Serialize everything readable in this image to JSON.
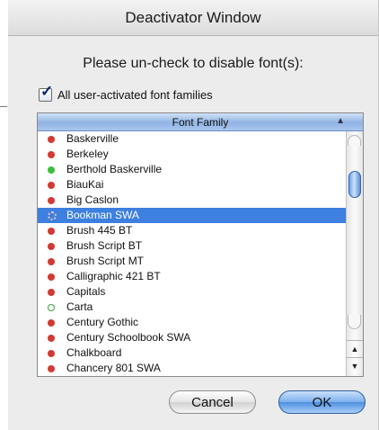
{
  "window": {
    "title": "Deactivator Window",
    "prompt": "Please un-check to disable font(s):"
  },
  "checkbox": {
    "label": "All user-activated font families",
    "checked": true
  },
  "list": {
    "column_header": "Font Family",
    "items": [
      {
        "name": "Baskerville",
        "status": "red"
      },
      {
        "name": "Berkeley",
        "status": "red"
      },
      {
        "name": "Berthold Baskerville",
        "status": "green"
      },
      {
        "name": "BiauKai",
        "status": "red"
      },
      {
        "name": "Big Caslon",
        "status": "red"
      },
      {
        "name": "Bookman SWA",
        "status": "broken",
        "selected": true
      },
      {
        "name": "Brush 445 BT",
        "status": "red"
      },
      {
        "name": "Brush Script BT",
        "status": "red"
      },
      {
        "name": "Brush Script MT",
        "status": "red"
      },
      {
        "name": "Calligraphic 421 BT",
        "status": "red"
      },
      {
        "name": "Capitals",
        "status": "red"
      },
      {
        "name": "Carta",
        "status": "hollow-green"
      },
      {
        "name": "Century Gothic",
        "status": "red"
      },
      {
        "name": "Century Schoolbook SWA",
        "status": "red"
      },
      {
        "name": "Chalkboard",
        "status": "red"
      },
      {
        "name": "Chancery 801 SWA",
        "status": "red"
      }
    ]
  },
  "buttons": {
    "cancel": "Cancel",
    "ok": "OK"
  },
  "colors": {
    "selection": "#3d80df",
    "active_dot": "#3bbf3b",
    "inactive_dot": "#d23a32"
  }
}
